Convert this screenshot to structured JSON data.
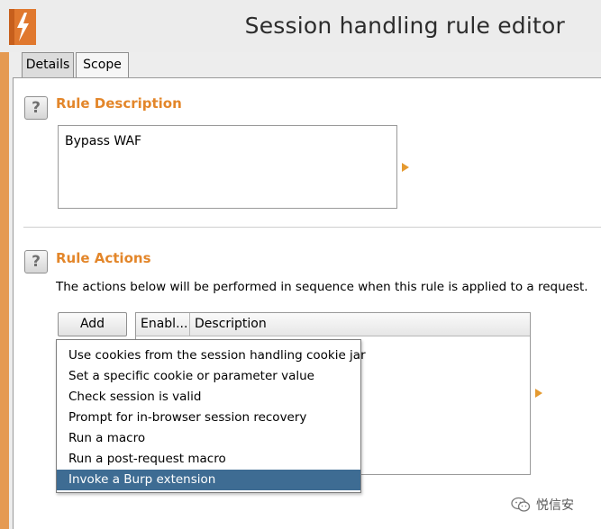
{
  "window": {
    "title": "Session handling rule editor",
    "logo_icon": "burp-lightning-icon",
    "accent_color": "#e3862a"
  },
  "tabs": [
    {
      "label": "Details",
      "active": true
    },
    {
      "label": "Scope",
      "active": false
    }
  ],
  "rule_description": {
    "help_label": "?",
    "title": "Rule Description",
    "value": "Bypass WAF"
  },
  "rule_actions": {
    "help_label": "?",
    "title": "Rule Actions",
    "instruction": "The actions below will be performed in sequence when this rule is applied to a request.",
    "add_label": "Add",
    "columns": [
      "Enabl...",
      "Description"
    ]
  },
  "add_menu": {
    "items": [
      "Use cookies from the session handling cookie jar",
      "Set a specific cookie or parameter value",
      "Check session is valid",
      "Prompt for in-browser session recovery",
      "Run a macro",
      "Run a post-request macro",
      "Invoke a Burp extension"
    ],
    "selected_index": 6,
    "selected_color": "#3e6c93"
  },
  "watermark": {
    "text": "悦信安",
    "icon": "wechat-icon"
  }
}
